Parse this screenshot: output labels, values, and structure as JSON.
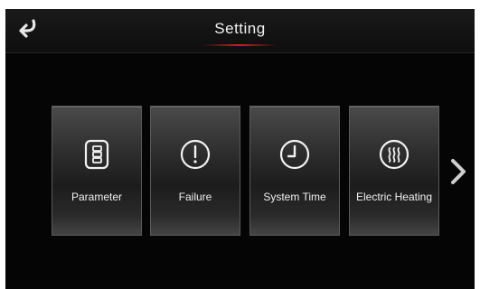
{
  "header": {
    "title": "Setting"
  },
  "tiles": [
    {
      "label": "Parameter",
      "icon": "list-icon"
    },
    {
      "label": "Failure",
      "icon": "alert-icon"
    },
    {
      "label": "System Time",
      "icon": "clock-icon"
    },
    {
      "label": "Electric Heating",
      "icon": "heating-icon"
    }
  ],
  "navigation": {
    "back_icon": "back-arrow-icon",
    "next_icon": "chevron-right-icon"
  },
  "colors": {
    "background": "#050505",
    "accent": "#d0231d",
    "text": "#ffffff"
  }
}
